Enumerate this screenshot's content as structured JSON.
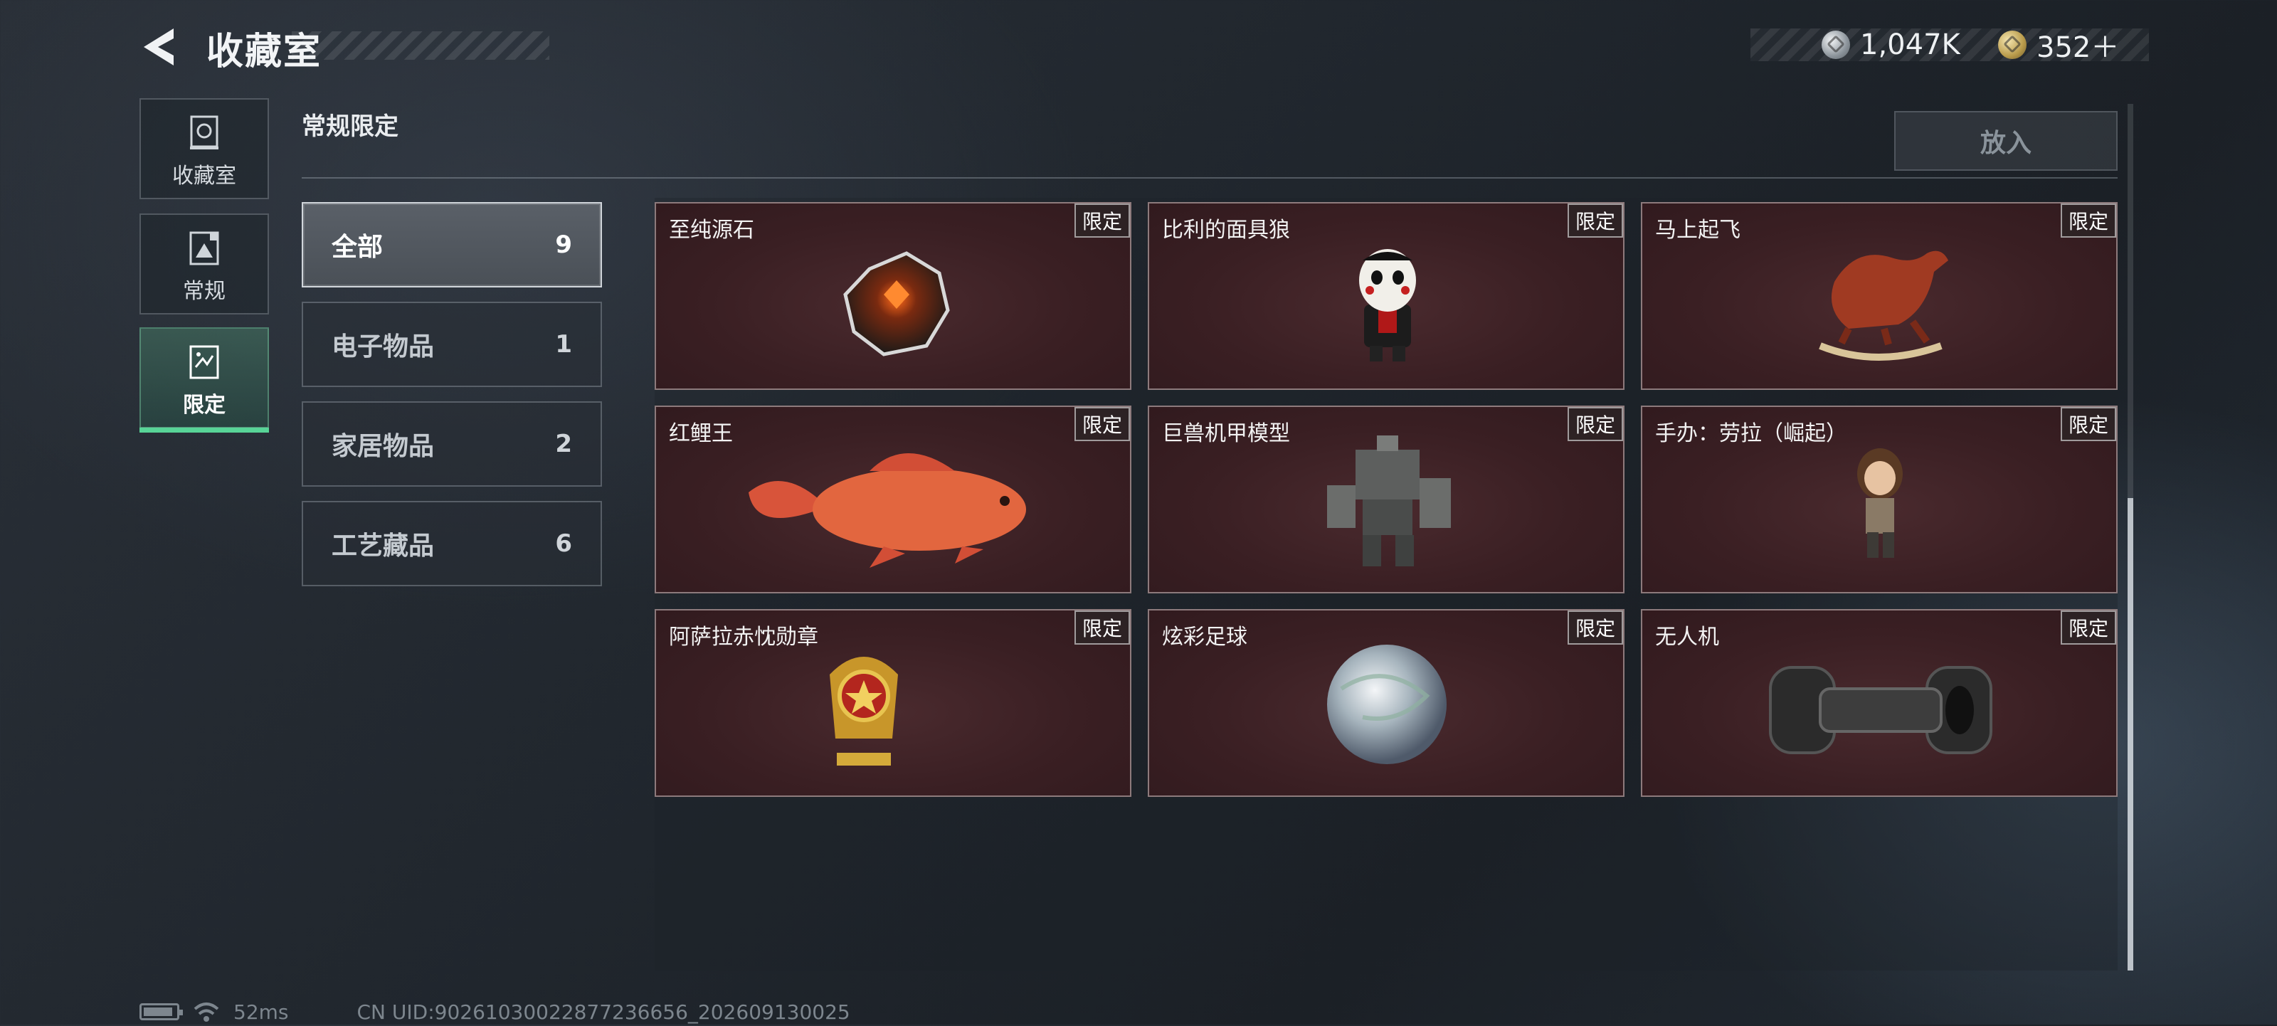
{
  "header": {
    "title": "收藏室",
    "silver_amount": "1,047K",
    "gold_amount": "352＋"
  },
  "nav": [
    {
      "label": "收藏室",
      "icon": "vault-icon"
    },
    {
      "label": "常规",
      "icon": "image-card-icon"
    },
    {
      "label": "限定",
      "icon": "limited-card-icon",
      "active": true
    }
  ],
  "section": {
    "title": "常规限定",
    "put_in_label": "放入"
  },
  "categories": [
    {
      "label": "全部",
      "count": "9",
      "active": true
    },
    {
      "label": "电子物品",
      "count": "1"
    },
    {
      "label": "家居物品",
      "count": "2"
    },
    {
      "label": "工艺藏品",
      "count": "6"
    }
  ],
  "items": [
    {
      "name": "至纯源石",
      "badge": "限定",
      "icon": "crystal-stone-icon"
    },
    {
      "name": "比利的面具狼",
      "badge": "限定",
      "icon": "puppet-figure-icon"
    },
    {
      "name": "马上起飞",
      "badge": "限定",
      "icon": "rocking-horse-icon"
    },
    {
      "name": "红鲤王",
      "badge": "限定",
      "icon": "red-carp-icon"
    },
    {
      "name": "巨兽机甲模型",
      "badge": "限定",
      "icon": "mech-model-icon"
    },
    {
      "name": "手办：劳拉（崛起）",
      "badge": "限定",
      "icon": "lara-figure-icon"
    },
    {
      "name": "阿萨拉赤忱勋章",
      "badge": "限定",
      "icon": "medal-icon"
    },
    {
      "name": "炫彩足球",
      "badge": "限定",
      "icon": "iridescent-ball-icon"
    },
    {
      "name": "无人机",
      "badge": "限定",
      "icon": "drone-icon"
    }
  ],
  "footer": {
    "ping": "52ms",
    "uid": "CN UID:9026103002287723665​6_202609130025"
  },
  "colors": {
    "accent": "#58d497",
    "card_bg": "#3a1f23"
  }
}
